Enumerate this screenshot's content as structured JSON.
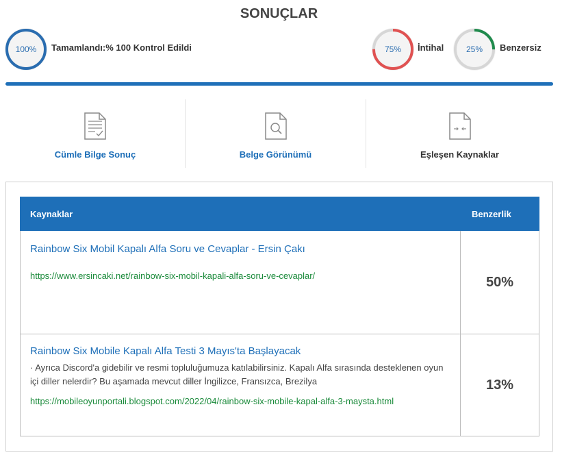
{
  "header": {
    "title": "SONUÇLAR",
    "completed": {
      "percent_label": "100%",
      "fraction": 1.0,
      "text": "Tamamlandı:% 100 Kontrol Edildi",
      "color": "#2a6db0"
    },
    "plagiarism": {
      "percent_label": "75%",
      "fraction": 0.75,
      "text": "İntihal",
      "color": "#e05252"
    },
    "unique": {
      "percent_label": "25%",
      "fraction": 0.25,
      "text": "Benzersiz",
      "color": "#1f8a4c"
    },
    "accent_color": "#1e6fb8"
  },
  "tabs": [
    {
      "label": "Cümle Bilge Sonuç",
      "icon": "document-check-icon"
    },
    {
      "label": "Belge Görünümü",
      "icon": "document-search-icon"
    },
    {
      "label": "Eşleşen Kaynaklar",
      "icon": "document-compare-icon"
    }
  ],
  "table": {
    "headers": {
      "sources": "Kaynaklar",
      "similarity": "Benzerlik"
    },
    "rows": [
      {
        "title": "Rainbow Six Mobil Kapalı Alfa Soru ve Cevaplar - Ersin Çakı",
        "snippet": "",
        "url": "https://www.ersincaki.net/rainbow-six-mobil-kapali-alfa-soru-ve-cevaplar/",
        "similarity": "50%"
      },
      {
        "title": "Rainbow Six Mobile Kapalı Alfa Testi 3 Mayıs'ta Başlayacak",
        "snippet": " · Ayrıca Discord'a gidebilir ve resmi topluluğumuza katılabilirsiniz. Kapalı Alfa sırasında desteklenen oyun içi diller nelerdir? Bu aşamada mevcut diller İngilizce, Fransızca, Brezilya",
        "url": "https://mobileoyunportali.blogspot.com/2022/04/rainbow-six-mobile-kapal-alfa-3-maysta.html",
        "similarity": "13%"
      }
    ]
  }
}
